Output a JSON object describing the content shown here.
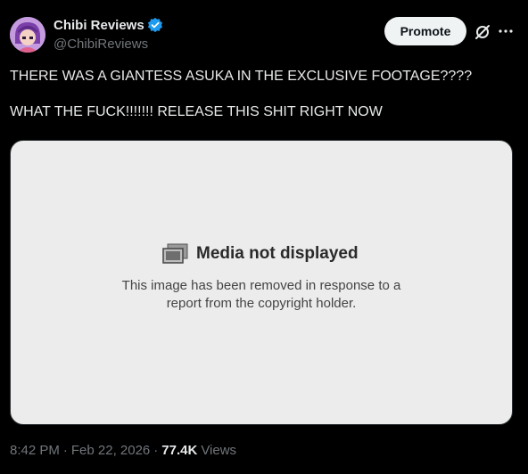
{
  "author": {
    "display_name": "Chibi Reviews",
    "handle": "@ChibiReviews",
    "verified": true,
    "verified_color": "#1d9bf0"
  },
  "actions": {
    "promote_label": "Promote",
    "grok_icon": "grok-icon",
    "more_icon": "more-dots-icon"
  },
  "tweet": {
    "line1": "THERE WAS A GIANTESS ASUKA IN THE EXCLUSIVE FOOTAGE????",
    "line2": "WHAT THE FUCK!!!!!!! RELEASE THIS SHIT RIGHT NOW"
  },
  "media": {
    "title": "Media not displayed",
    "desc_line1": "This image has been removed in response to a",
    "desc_line2": "report from the copyright holder.",
    "icon": "broken-image-icon"
  },
  "meta": {
    "time": "8:42 PM",
    "date": "Feb 22, 2026",
    "views_count": "77.4K",
    "views_label": "Views",
    "separator": "·"
  },
  "colors": {
    "background": "#000000",
    "text": "#e7e9ea",
    "muted": "#71767b",
    "media_bg": "#ececec"
  }
}
